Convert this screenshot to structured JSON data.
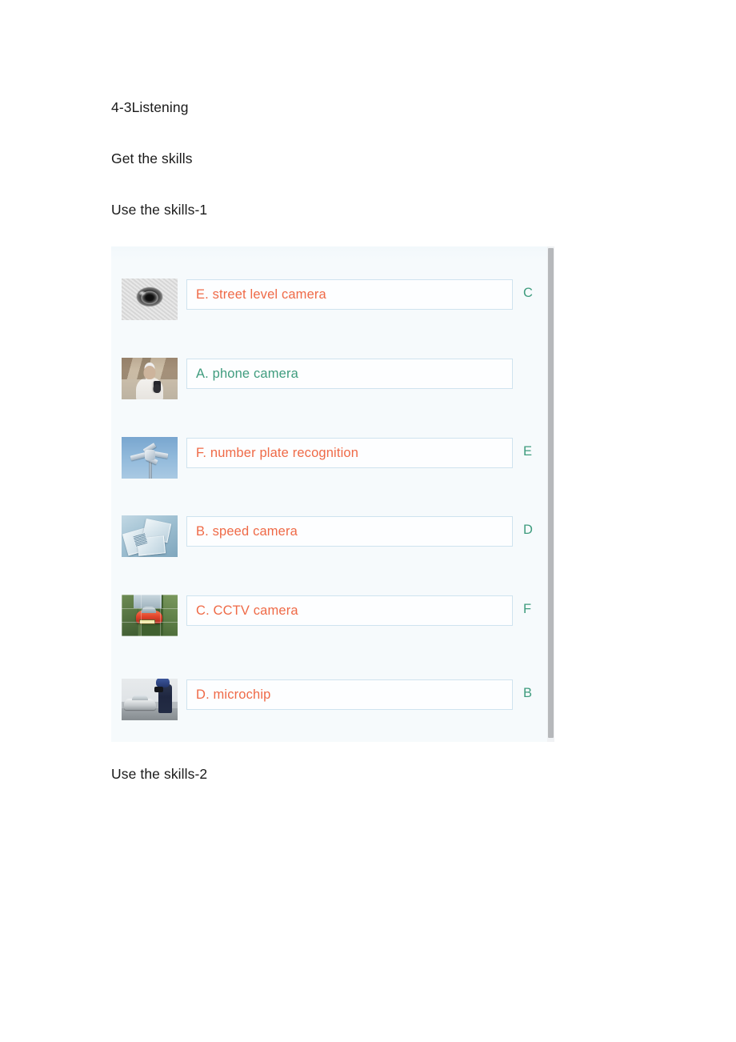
{
  "document": {
    "title": "4-3Listening",
    "heading_get_skills": "Get the skills",
    "heading_use_skills_1": "Use the skills-1",
    "heading_use_skills_2": "Use the skills-2"
  },
  "colors": {
    "panel_background": "#f5fafc",
    "answer_orange": "#ef6a47",
    "answer_green": "#3f9c7e",
    "box_border": "#cfe3ef",
    "scrollbar_thumb": "#b6b8bb"
  },
  "exercise": {
    "name": "matching-exercise",
    "rows": [
      {
        "image": "dome-cctv-camera-thumbnail",
        "answer": "E. street level camera",
        "answer_color": "orange",
        "letter": "C"
      },
      {
        "image": "person-holding-phone-thumbnail",
        "answer": "A. phone camera",
        "answer_color": "green",
        "letter": ""
      },
      {
        "image": "cameras-on-pole-thumbnail",
        "answer": "F.  number plate recognition",
        "answer_color": "orange",
        "letter": "E"
      },
      {
        "image": "microchips-thumbnail",
        "answer": "B. speed camera",
        "answer_color": "orange",
        "letter": "D"
      },
      {
        "image": "red-car-plate-recognition-thumbnail",
        "answer": "C. CCTV camera",
        "answer_color": "orange",
        "letter": "F"
      },
      {
        "image": "police-speed-gun-thumbnail",
        "answer": "D. microchip",
        "answer_color": "orange",
        "letter": "B"
      }
    ]
  }
}
